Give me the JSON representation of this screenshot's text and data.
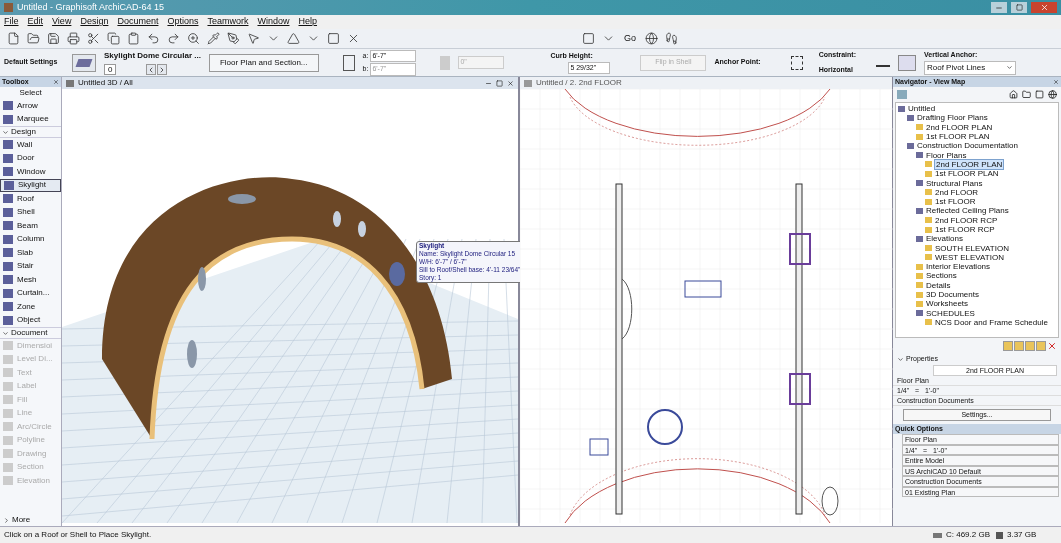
{
  "window": {
    "title": "Untitled - Graphisoft ArchiCAD-64 15"
  },
  "menu": [
    "File",
    "Edit",
    "View",
    "Design",
    "Document",
    "Options",
    "Teamwork",
    "Window",
    "Help"
  ],
  "toolbar": {
    "go_label": "Go"
  },
  "info_box": {
    "settings_label": "Default Settings",
    "element_name": "Skylight Dome Circular ...",
    "layer_label": "0",
    "view_button": "Floor Plan and Section...",
    "a_label": "a:",
    "a_value": "6'-7\"",
    "b_label": "b:",
    "b_value": "6'-7\"",
    "angle_value": "0\"",
    "curb_label": "Curb Height:",
    "curb_value": "5 29/32\"",
    "flip_button": {
      "label": "Flip in Shell",
      "disabled": true
    },
    "anchor_label": "Anchor Point:",
    "constraint_label": "Constraint:",
    "constraint_value": "Horizontal",
    "vertical_anchor_label": "Vertical Anchor:",
    "vertical_anchor_value": "Roof Pivot Lines"
  },
  "toolbox": {
    "title": "Toolbox",
    "select_label": "Select",
    "groups": [
      {
        "items": [
          {
            "label": "Arrow",
            "selected": false,
            "disabled": false
          },
          {
            "label": "Marquee",
            "selected": false,
            "disabled": false
          }
        ]
      },
      {
        "label": "Design",
        "items": [
          {
            "label": "Wall",
            "selected": false,
            "disabled": false
          },
          {
            "label": "Door",
            "selected": false,
            "disabled": false
          },
          {
            "label": "Window",
            "selected": false,
            "disabled": false
          },
          {
            "label": "Skylight",
            "selected": true,
            "disabled": false
          },
          {
            "label": "Roof",
            "selected": false,
            "disabled": false
          },
          {
            "label": "Shell",
            "selected": false,
            "disabled": false
          },
          {
            "label": "Beam",
            "selected": false,
            "disabled": false
          },
          {
            "label": "Column",
            "selected": false,
            "disabled": false
          },
          {
            "label": "Slab",
            "selected": false,
            "disabled": false
          },
          {
            "label": "Stair",
            "selected": false,
            "disabled": false
          },
          {
            "label": "Mesh",
            "selected": false,
            "disabled": false
          },
          {
            "label": "Curtain...",
            "selected": false,
            "disabled": false
          },
          {
            "label": "Zone",
            "selected": false,
            "disabled": false
          },
          {
            "label": "Object",
            "selected": false,
            "disabled": false
          }
        ]
      },
      {
        "label": "Document",
        "items": [
          {
            "label": "Dimensioi",
            "selected": false,
            "disabled": true
          },
          {
            "label": "Level Di...",
            "selected": false,
            "disabled": true
          },
          {
            "label": "Text",
            "selected": false,
            "disabled": true
          },
          {
            "label": "Label",
            "selected": false,
            "disabled": true
          },
          {
            "label": "Fill",
            "selected": false,
            "disabled": true
          },
          {
            "label": "Line",
            "selected": false,
            "disabled": true
          },
          {
            "label": "Arc/Circle",
            "selected": false,
            "disabled": true
          },
          {
            "label": "Polyline",
            "selected": false,
            "disabled": true
          },
          {
            "label": "Drawing",
            "selected": false,
            "disabled": true
          },
          {
            "label": "Section",
            "selected": false,
            "disabled": true
          },
          {
            "label": "Elevation",
            "selected": false,
            "disabled": true
          }
        ]
      }
    ],
    "more_label": "More"
  },
  "view_3d": {
    "title": "Untitled 3D / All",
    "tooltip": {
      "title": "Skylight",
      "lines": [
        "Name: Skylight Dome Circular 15",
        "W/H: 6'-7\" / 6'-7\"",
        "Sill to Roof/Shell base: 4'-11 23/64\"",
        "Story: 1"
      ]
    }
  },
  "view_plan": {
    "title": "Untitled / 2. 2nd FLOOR"
  },
  "navigator": {
    "title": "Navigator - View Map",
    "tree": [
      {
        "label": "Untitled",
        "selected": false,
        "children": [
          {
            "label": "Drafting Floor Plans",
            "selected": false,
            "children": [
              {
                "label": "2nd FLOOR PLAN",
                "selected": false
              },
              {
                "label": "1st FLOOR PLAN",
                "selected": false
              }
            ]
          },
          {
            "label": "Construction Documentation",
            "selected": false,
            "children": [
              {
                "label": "Floor Plans",
                "selected": false,
                "children": [
                  {
                    "label": "2nd FLOOR PLAN",
                    "selected": true
                  },
                  {
                    "label": "1st FLOOR PLAN",
                    "selected": false
                  }
                ]
              },
              {
                "label": "Structural Plans",
                "selected": false,
                "children": [
                  {
                    "label": "2nd FLOOR",
                    "selected": false
                  },
                  {
                    "label": "1st FLOOR",
                    "selected": false
                  }
                ]
              },
              {
                "label": "Reflected Ceiling Plans",
                "selected": false,
                "children": [
                  {
                    "label": "2nd FLOOR RCP",
                    "selected": false
                  },
                  {
                    "label": "1st FLOOR RCP",
                    "selected": false
                  }
                ]
              },
              {
                "label": "Elevations",
                "selected": false,
                "children": [
                  {
                    "label": "SOUTH ELEVATION",
                    "selected": false
                  },
                  {
                    "label": "WEST ELEVATION",
                    "selected": false
                  }
                ]
              },
              {
                "label": "Interior Elevations",
                "selected": false
              },
              {
                "label": "Sections",
                "selected": false
              },
              {
                "label": "Details",
                "selected": false
              },
              {
                "label": "3D Documents",
                "selected": false
              },
              {
                "label": "Worksheets",
                "selected": false
              },
              {
                "label": "SCHEDULES",
                "selected": false,
                "children": [
                  {
                    "label": "NCS Door and Frame Schedule",
                    "selected": false
                  }
                ]
              }
            ]
          }
        ]
      }
    ]
  },
  "properties": {
    "title": "Properties",
    "name": "2nd FLOOR PLAN",
    "rows": [
      "Floor Plan",
      "1/4\"   =   1'-0\"",
      "Construction Documents"
    ],
    "button": "Settings..."
  },
  "quick_options": {
    "title": "Quick Options",
    "items": [
      "Floor Plan",
      "1/4\"   =   1'-0\"",
      "Entire Model",
      "US ArchiCAD 10 Default",
      "Construction Documents",
      "01 Existing Plan"
    ]
  },
  "status_bar": {
    "message": "Click on a Roof or Shell to Place Skylight.",
    "disk": "C: 469.2 GB",
    "memory": "3.37 GB"
  }
}
